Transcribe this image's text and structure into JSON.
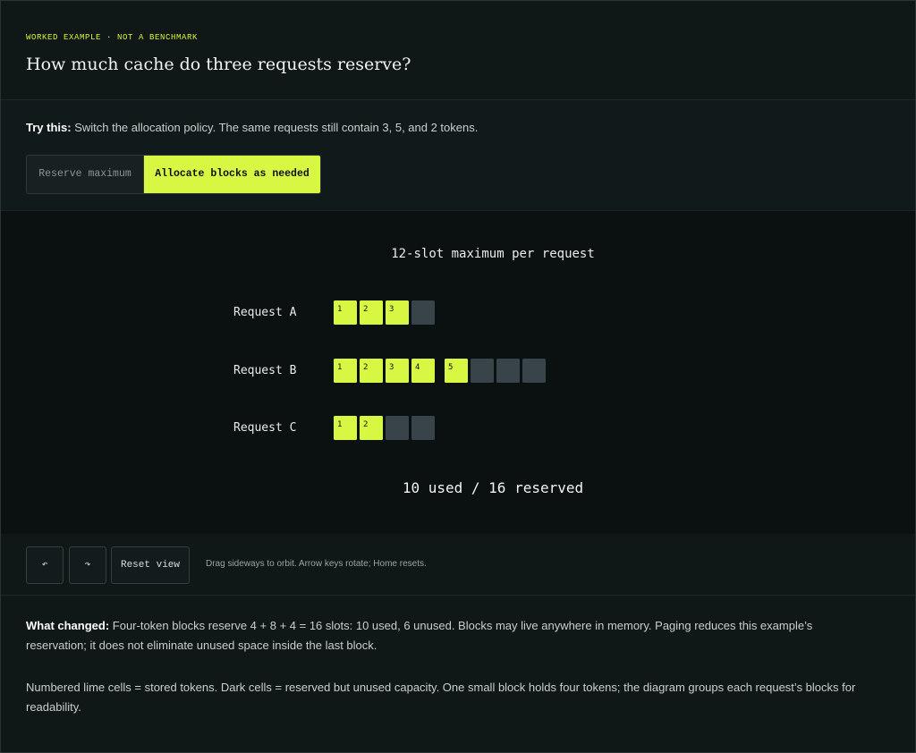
{
  "header": {
    "eyebrow": "WORKED EXAMPLE · NOT A BENCHMARK",
    "title": "How much cache do three requests reserve?"
  },
  "try": {
    "lead": "Try this:",
    "text": " Switch the allocation policy. The same requests still contain 3, 5, and 2 tokens."
  },
  "policy": {
    "options": [
      "Reserve maximum",
      "Allocate blocks as needed"
    ],
    "selected": "Allocate blocks as needed"
  },
  "diagram": {
    "caption": "12-slot maximum per request",
    "block_size": 4,
    "requests": [
      {
        "label": "Request A",
        "tokens": [
          1,
          2,
          3
        ],
        "blocks": 1
      },
      {
        "label": "Request B",
        "tokens": [
          1,
          2,
          3,
          4,
          5
        ],
        "blocks": 2
      },
      {
        "label": "Request C",
        "tokens": [
          1,
          2
        ],
        "blocks": 1
      }
    ],
    "summary": "10 used / 16 reserved",
    "colors": {
      "used": "#d8f743",
      "unused": "#38444a",
      "background": "#0b1111"
    }
  },
  "controls": {
    "undo_icon": "rotate-left-icon",
    "undo_glyph": "↶",
    "redo_icon": "rotate-right-icon",
    "redo_glyph": "↷",
    "reset_label": "Reset view",
    "hint": "Drag sideways to orbit. Arrow keys rotate; Home resets."
  },
  "notes": {
    "what_changed_lead": "What changed:",
    "what_changed_text": " Four-token blocks reserve 4 + 8 + 4 = 16 slots: 10 used, 6 unused. Blocks may live anywhere in memory. Paging reduces this example’s reservation; it does not eliminate unused space inside the last block.",
    "legend": "Numbered lime cells = stored tokens. Dark cells = reserved but unused capacity. One small block holds four tokens; the diagram groups each request’s blocks for readability."
  }
}
